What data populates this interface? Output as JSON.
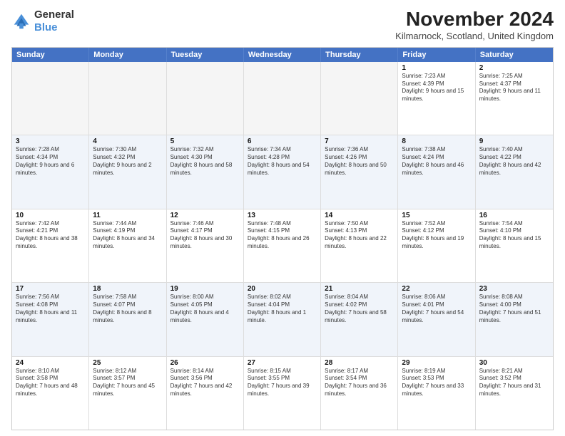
{
  "logo": {
    "line1": "General",
    "line2": "Blue"
  },
  "header": {
    "title": "November 2024",
    "location": "Kilmarnock, Scotland, United Kingdom"
  },
  "weekdays": [
    "Sunday",
    "Monday",
    "Tuesday",
    "Wednesday",
    "Thursday",
    "Friday",
    "Saturday"
  ],
  "weeks": [
    [
      {
        "day": "",
        "info": ""
      },
      {
        "day": "",
        "info": ""
      },
      {
        "day": "",
        "info": ""
      },
      {
        "day": "",
        "info": ""
      },
      {
        "day": "",
        "info": ""
      },
      {
        "day": "1",
        "info": "Sunrise: 7:23 AM\nSunset: 4:39 PM\nDaylight: 9 hours and 15 minutes."
      },
      {
        "day": "2",
        "info": "Sunrise: 7:25 AM\nSunset: 4:37 PM\nDaylight: 9 hours and 11 minutes."
      }
    ],
    [
      {
        "day": "3",
        "info": "Sunrise: 7:28 AM\nSunset: 4:34 PM\nDaylight: 9 hours and 6 minutes."
      },
      {
        "day": "4",
        "info": "Sunrise: 7:30 AM\nSunset: 4:32 PM\nDaylight: 9 hours and 2 minutes."
      },
      {
        "day": "5",
        "info": "Sunrise: 7:32 AM\nSunset: 4:30 PM\nDaylight: 8 hours and 58 minutes."
      },
      {
        "day": "6",
        "info": "Sunrise: 7:34 AM\nSunset: 4:28 PM\nDaylight: 8 hours and 54 minutes."
      },
      {
        "day": "7",
        "info": "Sunrise: 7:36 AM\nSunset: 4:26 PM\nDaylight: 8 hours and 50 minutes."
      },
      {
        "day": "8",
        "info": "Sunrise: 7:38 AM\nSunset: 4:24 PM\nDaylight: 8 hours and 46 minutes."
      },
      {
        "day": "9",
        "info": "Sunrise: 7:40 AM\nSunset: 4:22 PM\nDaylight: 8 hours and 42 minutes."
      }
    ],
    [
      {
        "day": "10",
        "info": "Sunrise: 7:42 AM\nSunset: 4:21 PM\nDaylight: 8 hours and 38 minutes."
      },
      {
        "day": "11",
        "info": "Sunrise: 7:44 AM\nSunset: 4:19 PM\nDaylight: 8 hours and 34 minutes."
      },
      {
        "day": "12",
        "info": "Sunrise: 7:46 AM\nSunset: 4:17 PM\nDaylight: 8 hours and 30 minutes."
      },
      {
        "day": "13",
        "info": "Sunrise: 7:48 AM\nSunset: 4:15 PM\nDaylight: 8 hours and 26 minutes."
      },
      {
        "day": "14",
        "info": "Sunrise: 7:50 AM\nSunset: 4:13 PM\nDaylight: 8 hours and 22 minutes."
      },
      {
        "day": "15",
        "info": "Sunrise: 7:52 AM\nSunset: 4:12 PM\nDaylight: 8 hours and 19 minutes."
      },
      {
        "day": "16",
        "info": "Sunrise: 7:54 AM\nSunset: 4:10 PM\nDaylight: 8 hours and 15 minutes."
      }
    ],
    [
      {
        "day": "17",
        "info": "Sunrise: 7:56 AM\nSunset: 4:08 PM\nDaylight: 8 hours and 11 minutes."
      },
      {
        "day": "18",
        "info": "Sunrise: 7:58 AM\nSunset: 4:07 PM\nDaylight: 8 hours and 8 minutes."
      },
      {
        "day": "19",
        "info": "Sunrise: 8:00 AM\nSunset: 4:05 PM\nDaylight: 8 hours and 4 minutes."
      },
      {
        "day": "20",
        "info": "Sunrise: 8:02 AM\nSunset: 4:04 PM\nDaylight: 8 hours and 1 minute."
      },
      {
        "day": "21",
        "info": "Sunrise: 8:04 AM\nSunset: 4:02 PM\nDaylight: 7 hours and 58 minutes."
      },
      {
        "day": "22",
        "info": "Sunrise: 8:06 AM\nSunset: 4:01 PM\nDaylight: 7 hours and 54 minutes."
      },
      {
        "day": "23",
        "info": "Sunrise: 8:08 AM\nSunset: 4:00 PM\nDaylight: 7 hours and 51 minutes."
      }
    ],
    [
      {
        "day": "24",
        "info": "Sunrise: 8:10 AM\nSunset: 3:58 PM\nDaylight: 7 hours and 48 minutes."
      },
      {
        "day": "25",
        "info": "Sunrise: 8:12 AM\nSunset: 3:57 PM\nDaylight: 7 hours and 45 minutes."
      },
      {
        "day": "26",
        "info": "Sunrise: 8:14 AM\nSunset: 3:56 PM\nDaylight: 7 hours and 42 minutes."
      },
      {
        "day": "27",
        "info": "Sunrise: 8:15 AM\nSunset: 3:55 PM\nDaylight: 7 hours and 39 minutes."
      },
      {
        "day": "28",
        "info": "Sunrise: 8:17 AM\nSunset: 3:54 PM\nDaylight: 7 hours and 36 minutes."
      },
      {
        "day": "29",
        "info": "Sunrise: 8:19 AM\nSunset: 3:53 PM\nDaylight: 7 hours and 33 minutes."
      },
      {
        "day": "30",
        "info": "Sunrise: 8:21 AM\nSunset: 3:52 PM\nDaylight: 7 hours and 31 minutes."
      }
    ]
  ]
}
